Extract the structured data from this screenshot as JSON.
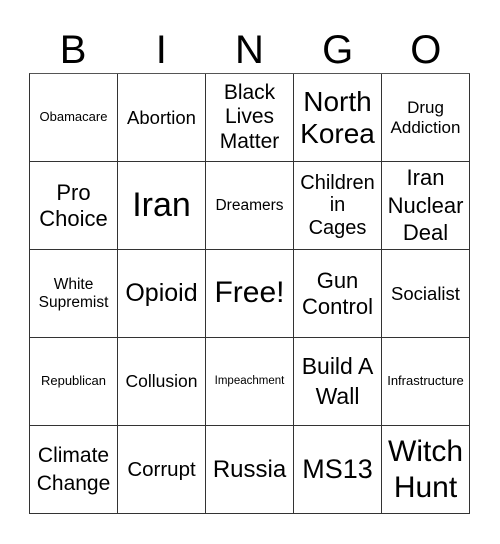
{
  "header": {
    "letters": [
      "B",
      "I",
      "N",
      "G",
      "O"
    ]
  },
  "board": {
    "rows": [
      [
        "Obamacare",
        "Abortion",
        "Black Lives Matter",
        "North Korea",
        "Drug Addiction"
      ],
      [
        "Pro Choice",
        "Iran",
        "Dreamers",
        "Children in Cages",
        "Iran Nuclear Deal"
      ],
      [
        "White Supremist",
        "Opioid",
        "Free!",
        "Gun Control",
        "Socialist"
      ],
      [
        "Republican",
        "Collusion",
        "Impeachment",
        "Build A Wall",
        "Infrastructure"
      ],
      [
        "Climate Change",
        "Corrupt",
        "Russia",
        "MS13",
        "Witch Hunt"
      ]
    ],
    "free_space": "Free!"
  }
}
